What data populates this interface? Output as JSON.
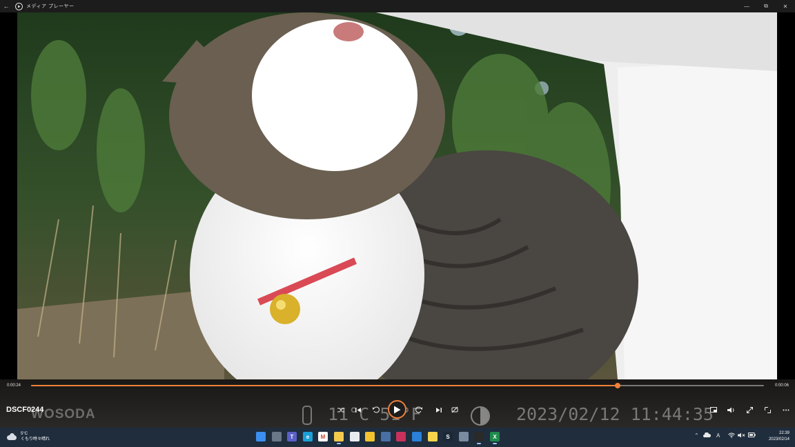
{
  "window": {
    "title": "メディア プレーヤー",
    "back_icon": "back-arrow-icon",
    "buttons": [
      "minimize-icon",
      "restore-icon",
      "close-icon"
    ]
  },
  "player": {
    "current_time": "0:00:24",
    "remaining_time": "0:00:06",
    "progress": 0.8,
    "file_name": "DSCF0244",
    "accent_color": "#f0813a"
  },
  "video_stamp": {
    "brand": "WOSODA",
    "temperature": "11°C   51°F",
    "datetime": "2023/02/12   11:44:35"
  },
  "controls": {
    "left": [
      "shuffle-icon",
      "previous-icon",
      "rewind-10-icon"
    ],
    "play": "play-icon",
    "right": [
      "forward-30-icon",
      "next-icon",
      "repeat-icon",
      "cast-icon"
    ],
    "far_right": [
      "miniplayer-icon",
      "volume-icon",
      "fullscreen-icon",
      "aspect-ratio-icon",
      "more-icon"
    ]
  },
  "taskbar": {
    "weather": {
      "temp": "5°C",
      "condition": "くもり時々晴れ",
      "icon": "cloud-icon"
    },
    "apps": [
      {
        "name": "start",
        "color": "#3b8ff0",
        "glyph": ""
      },
      {
        "name": "task-view",
        "color": "#6a7788",
        "glyph": ""
      },
      {
        "name": "teams",
        "color": "#5b5fc7",
        "glyph": "T"
      },
      {
        "name": "edge",
        "color": "#1aa0d6",
        "glyph": "e"
      },
      {
        "name": "gmail",
        "color": "#ffffff",
        "glyph": "M"
      },
      {
        "name": "file-explorer",
        "color": "#f2c94c",
        "glyph": ""
      },
      {
        "name": "store",
        "color": "#e9ecef",
        "glyph": ""
      },
      {
        "name": "chrome",
        "color": "#f2c230",
        "glyph": ""
      },
      {
        "name": "calculator",
        "color": "#4a6fa5",
        "glyph": ""
      },
      {
        "name": "dropbox-drop",
        "color": "#c8325a",
        "glyph": ""
      },
      {
        "name": "mail",
        "color": "#2b80d8",
        "glyph": ""
      },
      {
        "name": "sticky-notes",
        "color": "#f7d54a",
        "glyph": ""
      },
      {
        "name": "steam",
        "color": "#1b2838",
        "glyph": "S"
      },
      {
        "name": "settings",
        "color": "#7a8aa0",
        "glyph": ""
      },
      {
        "name": "media-player",
        "color": "#2a2a2a",
        "glyph": ""
      },
      {
        "name": "excel",
        "color": "#1f8a4c",
        "glyph": "X"
      }
    ],
    "tray": [
      "chevron-up-icon",
      "onedrive-icon",
      "ime-icon",
      "wifi-icon",
      "volume-mute-icon",
      "battery-icon"
    ],
    "ime_label": "A",
    "time": "22:39",
    "date": "2023/02/14"
  }
}
